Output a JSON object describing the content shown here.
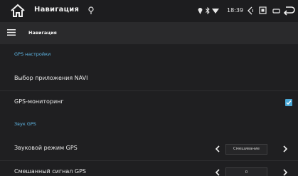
{
  "statusbar": {
    "app_title": "Навигация",
    "clock": "18:39",
    "icons": [
      "home-icon",
      "location-pin-icon",
      "location-icon",
      "bluetooth-icon",
      "wifi-icon",
      "volume-icon",
      "screenshot-icon",
      "window-icon",
      "back-icon"
    ]
  },
  "toolbar": {
    "title": "Навигация",
    "menu_icon": "menu-icon"
  },
  "sections": {
    "gps_settings": "GPS настройки",
    "gps_sound": "Звук GPS"
  },
  "rows": {
    "navi_app": "Выбор приложения NAVI",
    "gps_monitoring": "GPS-мониторинг",
    "gps_monitoring_checked": true,
    "gps_sound_mode": "Звуковой режим GPS",
    "gps_sound_mode_value": "Смешивание",
    "gps_mixed_signal": "Смешанный сигнал GPS",
    "gps_mixed_signal_value": "0"
  },
  "colors": {
    "accent": "#4aa9d8",
    "section_header": "#5fb7e6",
    "background": "#1f1f21"
  }
}
